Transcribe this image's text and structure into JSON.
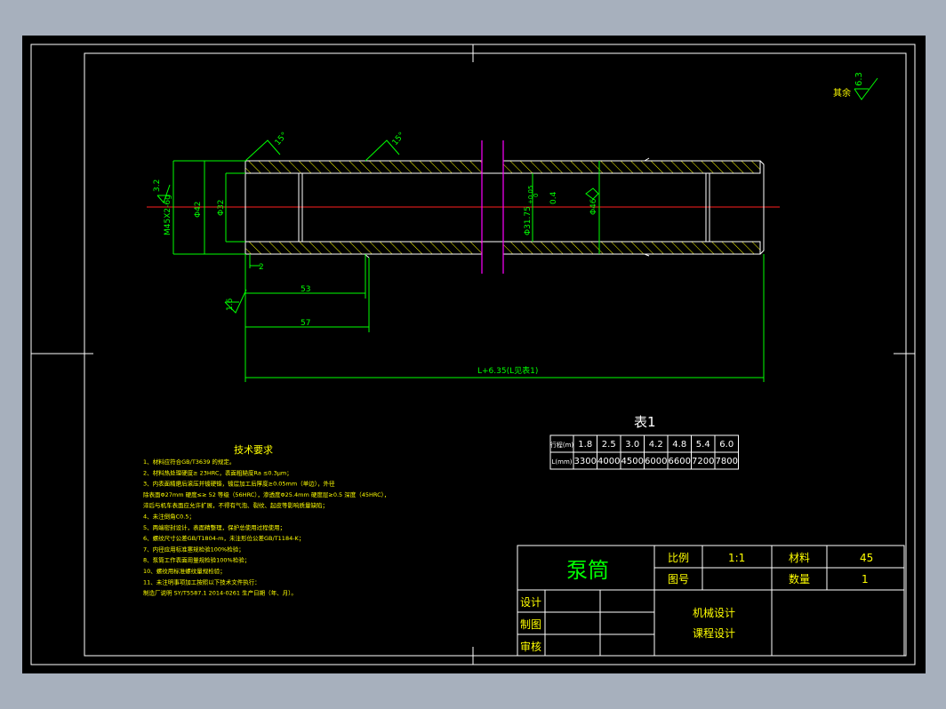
{
  "colors": {
    "background": "#a7b0bd",
    "paper": "#000000",
    "border": "#ffffff",
    "geometry": "#ffffff",
    "dimension": "#00ff00",
    "centerline": "#ff2020",
    "cut_plane": "#ff00ff",
    "hatch": "#ffff00",
    "table": "#ffffff"
  },
  "surface_finish": {
    "label": "其余",
    "value": "6.3"
  },
  "dims": {
    "thread": "M45X2-6g",
    "finish_left": "3.2",
    "d42": "Φ42",
    "d32": "Φ32",
    "d31": "Φ31.75",
    "tol_top": "+0.05",
    "tol_bot": "0",
    "roundness": "0.4",
    "d46": "Φ46",
    "chamfer_a": "15°",
    "chamfer_b": "15°",
    "d2": "2",
    "d53": "53",
    "d57": "57",
    "finish_bottom": "1.6",
    "length": "L+6.35(L见表1)"
  },
  "table1": {
    "title": "表1",
    "row1": [
      "行程(m)",
      "1.8",
      "2.5",
      "3.0",
      "4.2",
      "4.8",
      "5.4",
      "6.0"
    ],
    "row2": [
      "L(mm)",
      "3300",
      "4000",
      "4500",
      "6000",
      "6600",
      "7200",
      "7800"
    ]
  },
  "tech": {
    "title": "技术要求",
    "lines": [
      "1、材料应符合GB/T3639 的规定。",
      "2、材料热处理硬度≥ 23HRC，表面粗糙度Ra ≤0.3μm；",
      "3、内表面精磨后滚压并镀硬铬，镀层加工后厚度≥0.05mm（单边），外径",
      "   除表面Φ27mm 硬度≤≥ 52 等级（56HRC），渗透度Φ25.4mm 硬度层≥0.5 深度（45HRC），",
      "   淬后与机车表面应允许扩展，不得有气泡、裂纹、起皮等影响质量缺陷；",
      "4、未注倒角C0.5；",
      "5、两端密封设计，表面精整理，保护总使用过程使用；",
      "6、螺纹尺寸公差GB/T1804-m，未注形位公差GB/T1184-K；",
      "7、内径应用标准塞规检验100%检验；",
      "8、泵筒工作表面用量规检验100%检验；",
      "10、螺纹用标准螺纹量规检验；",
      "11、未注明事项加工按照以下技术文件执行：",
      "   制造厂说明 SY/T5587.1 2014-0261    生产日期（年、月）。"
    ]
  },
  "title_block": {
    "name": "泵筒",
    "scale_label": "比例",
    "scale_value": "1:1",
    "material_label": "材料",
    "material_value": "45",
    "drawing_no_label": "图号",
    "quantity_label": "数量",
    "quantity_value": "1",
    "design": "设计",
    "drawn": "制图",
    "review": "审核",
    "course1": "机械设计",
    "course2": "课程设计"
  }
}
